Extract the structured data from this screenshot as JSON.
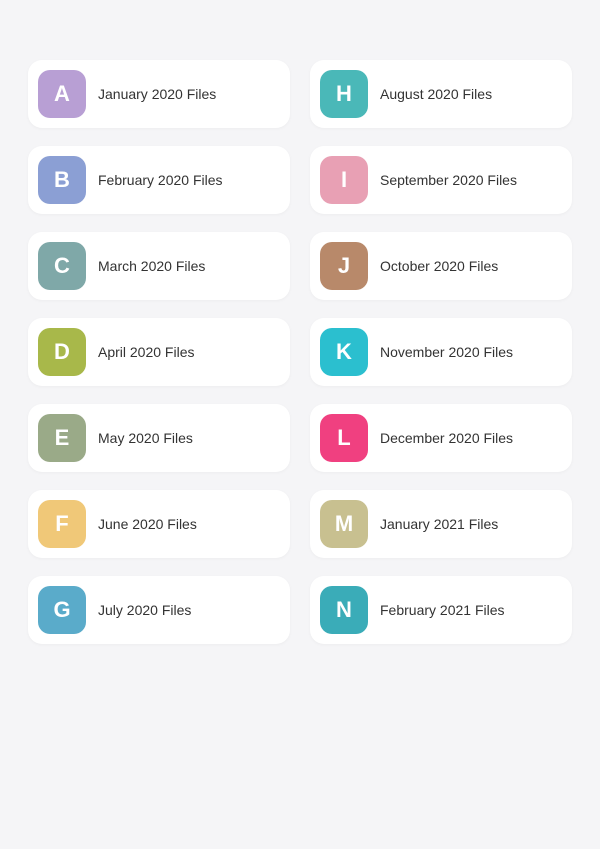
{
  "folders": [
    {
      "id": "a",
      "letter": "A",
      "label": "January 2020 Files",
      "color": "#b89fd4"
    },
    {
      "id": "h",
      "letter": "H",
      "label": "August 2020 Files",
      "color": "#4ab8b8"
    },
    {
      "id": "b",
      "letter": "B",
      "label": "February 2020 Files",
      "color": "#8b9fd4"
    },
    {
      "id": "i",
      "letter": "I",
      "label": "September 2020 Files",
      "color": "#e8a0b4"
    },
    {
      "id": "c",
      "letter": "C",
      "label": "March 2020 Files",
      "color": "#7fa8a8"
    },
    {
      "id": "j",
      "letter": "J",
      "label": "October 2020 Files",
      "color": "#b8896a"
    },
    {
      "id": "d",
      "letter": "D",
      "label": "April 2020 Files",
      "color": "#a8b84a"
    },
    {
      "id": "k",
      "letter": "K",
      "label": "November 2020 Files",
      "color": "#2bbfcf"
    },
    {
      "id": "e",
      "letter": "E",
      "label": "May 2020 Files",
      "color": "#9aaa88"
    },
    {
      "id": "l",
      "letter": "L",
      "label": "December 2020 Files",
      "color": "#f04080"
    },
    {
      "id": "f",
      "letter": "F",
      "label": "June 2020 Files",
      "color": "#f0c878"
    },
    {
      "id": "m",
      "letter": "M",
      "label": "January 2021 Files",
      "color": "#c8c090"
    },
    {
      "id": "g",
      "letter": "G",
      "label": "July 2020 Files",
      "color": "#5aabca"
    },
    {
      "id": "n",
      "letter": "N",
      "label": "February 2021 Files",
      "color": "#3aacb8"
    }
  ]
}
